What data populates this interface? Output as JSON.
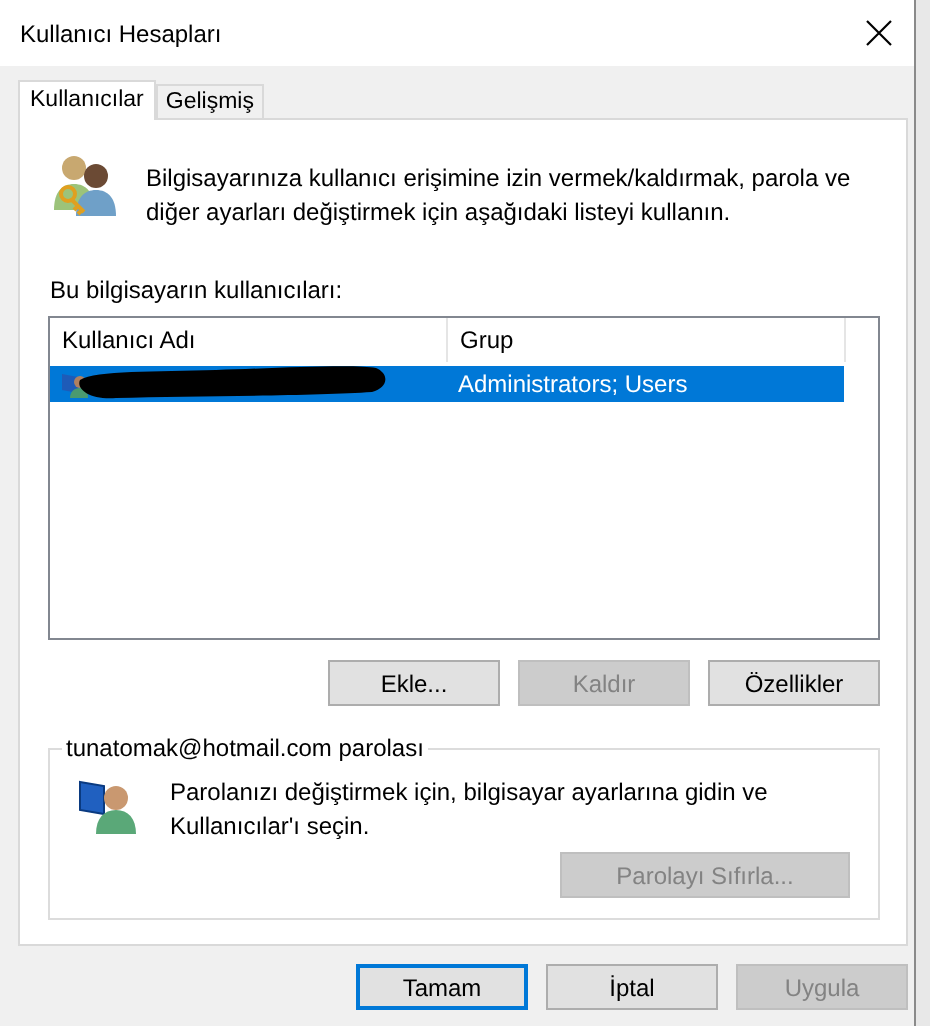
{
  "window": {
    "title": "Kullanıcı Hesapları"
  },
  "tabs": [
    {
      "label": "Kullanıcılar",
      "selected": true
    },
    {
      "label": "Gelişmiş",
      "selected": false
    }
  ],
  "intro": "Bilgisayarınıza kullanıcı erişimine izin vermek/kaldırmak, parola ve diğer ayarları değiştirmek için aşağıdaki listeyi kullanın.",
  "users_label": "Bu bilgisayarın kullanıcıları:",
  "users_table": {
    "columns": [
      "Kullanıcı Adı",
      "Grup"
    ],
    "rows": [
      {
        "name_redacted": true,
        "group": "Administrators; Users",
        "selected": true
      }
    ]
  },
  "user_buttons": [
    {
      "label": "Ekle...",
      "disabled": false
    },
    {
      "label": "Kaldır",
      "disabled": true
    },
    {
      "label": "Özellikler",
      "disabled": false
    }
  ],
  "password_group": {
    "title": "tunatomak@hotmail.com parolası",
    "text": "Parolanızı değiştirmek için, bilgisayar ayarlarına gidin ve Kullanıcılar'ı seçin.",
    "button": {
      "label": "Parolayı Sıfırla...",
      "disabled": true
    }
  },
  "dialog_buttons": [
    {
      "label": "Tamam",
      "default": true,
      "disabled": false
    },
    {
      "label": "İptal",
      "default": false,
      "disabled": false
    },
    {
      "label": "Uygula",
      "default": false,
      "disabled": true
    }
  ]
}
